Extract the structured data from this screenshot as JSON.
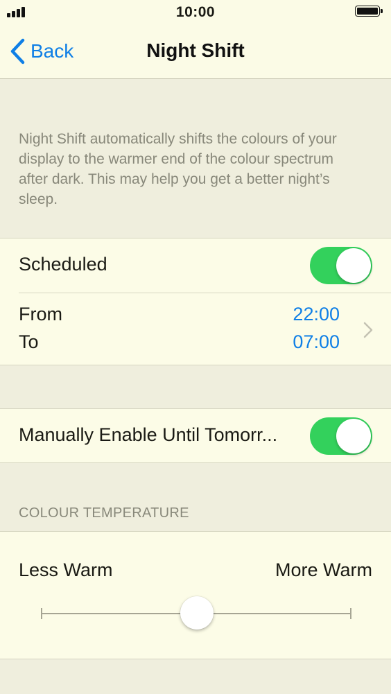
{
  "status_bar": {
    "time": "10:00",
    "signal_icon": "signal-bars-icon",
    "battery_icon": "battery-full-icon"
  },
  "nav": {
    "back_label": "Back",
    "title": "Night Shift",
    "back_icon": "chevron-left-icon"
  },
  "description": "Night Shift automatically shifts the colours of your display to the warmer end of the colour spectrum after dark. This may help you get a better night’s sleep.",
  "scheduled": {
    "label": "Scheduled",
    "enabled": true
  },
  "schedule_times": {
    "from_label": "From",
    "to_label": "To",
    "from_value": "22:00",
    "to_value": "07:00",
    "chevron_icon": "chevron-right-icon"
  },
  "manual": {
    "label": "Manually Enable Until Tomorr...",
    "enabled": true
  },
  "colour_temperature": {
    "section_header": "COLOUR TEMPERATURE",
    "min_label": "Less Warm",
    "max_label": "More Warm",
    "value_fraction": 0.5
  },
  "colors": {
    "accent": "#0f7fe6",
    "switch_on": "#33d15c",
    "background": "#efeedd",
    "cell_background": "#fcfce7",
    "secondary_text": "#88887a"
  }
}
